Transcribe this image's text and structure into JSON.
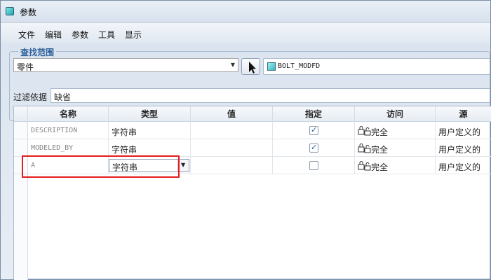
{
  "window": {
    "title": "参数"
  },
  "menu": [
    "文件",
    "编辑",
    "参数",
    "工具",
    "显示"
  ],
  "search_scope": {
    "label": "查找范围",
    "scope_value": "零件",
    "model_name": "BOLT_MODFD"
  },
  "filter": {
    "label": "过滤依据",
    "value": "缺省"
  },
  "table": {
    "headers": [
      "名称",
      "类型",
      "值",
      "指定",
      "访问",
      "源"
    ],
    "rows": [
      {
        "name": "DESCRIPTION",
        "type": "字符串",
        "value": "",
        "designated": true,
        "access": "完全",
        "source": "用户定义的"
      },
      {
        "name": "MODELED_BY",
        "type": "字符串",
        "value": "",
        "designated": true,
        "access": "完全",
        "source": "用户定义的"
      },
      {
        "name": "A",
        "type": "字符串",
        "value": "",
        "designated": false,
        "access": "完全",
        "source": "用户定义的"
      }
    ]
  },
  "colors": {
    "accent": "#2d5f9a",
    "highlight": "#e41d1d",
    "check": "#2060a8"
  },
  "icons": [
    "app-icon",
    "model-part-icon",
    "cursor-arrow-icon",
    "lock-icon",
    "chevron-down-icon",
    "checkmark-icon"
  ]
}
